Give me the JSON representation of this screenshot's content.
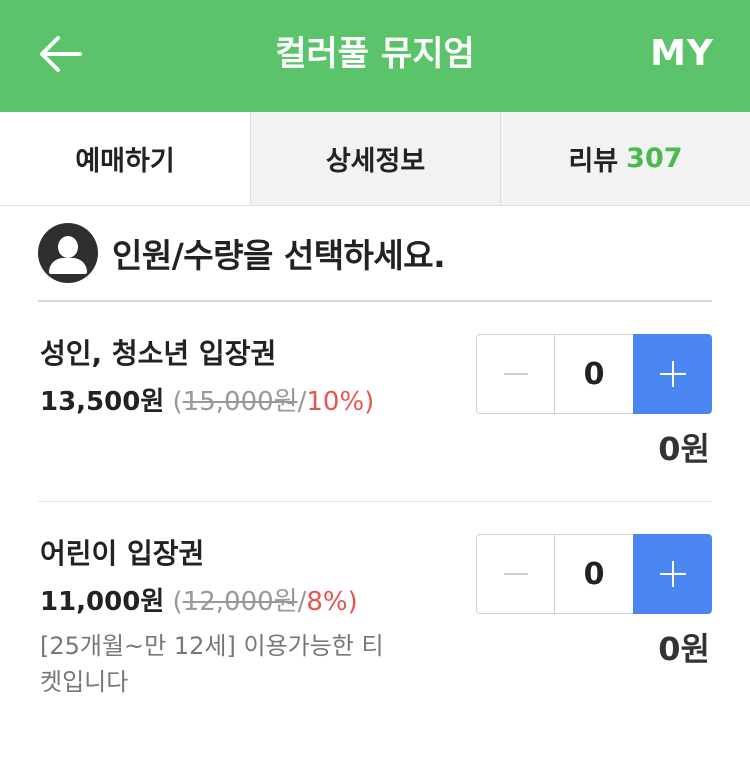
{
  "header": {
    "title": "컬러풀 뮤지엄",
    "my_label": "MY",
    "back_icon": "arrow-left-icon",
    "background": "#5bc46a"
  },
  "tabs": [
    {
      "label": "예매하기",
      "active": true
    },
    {
      "label": "상세정보",
      "active": false
    },
    {
      "label": "리뷰",
      "count": "307",
      "active": false
    }
  ],
  "section": {
    "title": "인원/수량을 선택하세요.",
    "icon": "person-icon"
  },
  "tickets": [
    {
      "name": "성인, 청소년 입장권",
      "price": "13,500원",
      "paren_open": "(",
      "original_price": "15,000원",
      "slash": "/",
      "discount": "10%",
      "paren_close": ")",
      "quantity": "0",
      "total": "0원"
    },
    {
      "name": "어린이 입장권",
      "price": "11,000원",
      "paren_open": "(",
      "original_price": "12,000원",
      "slash": "/",
      "discount": "8%",
      "paren_close": ")",
      "note": "[25개월~만 12세] 이용가능한 티켓입니다",
      "quantity": "0",
      "total": "0원"
    }
  ],
  "colors": {
    "accent_green": "#5bc46a",
    "review_count_green": "#4cb94d",
    "plus_button_blue": "#4b86f3",
    "discount_red": "#e8554f"
  }
}
